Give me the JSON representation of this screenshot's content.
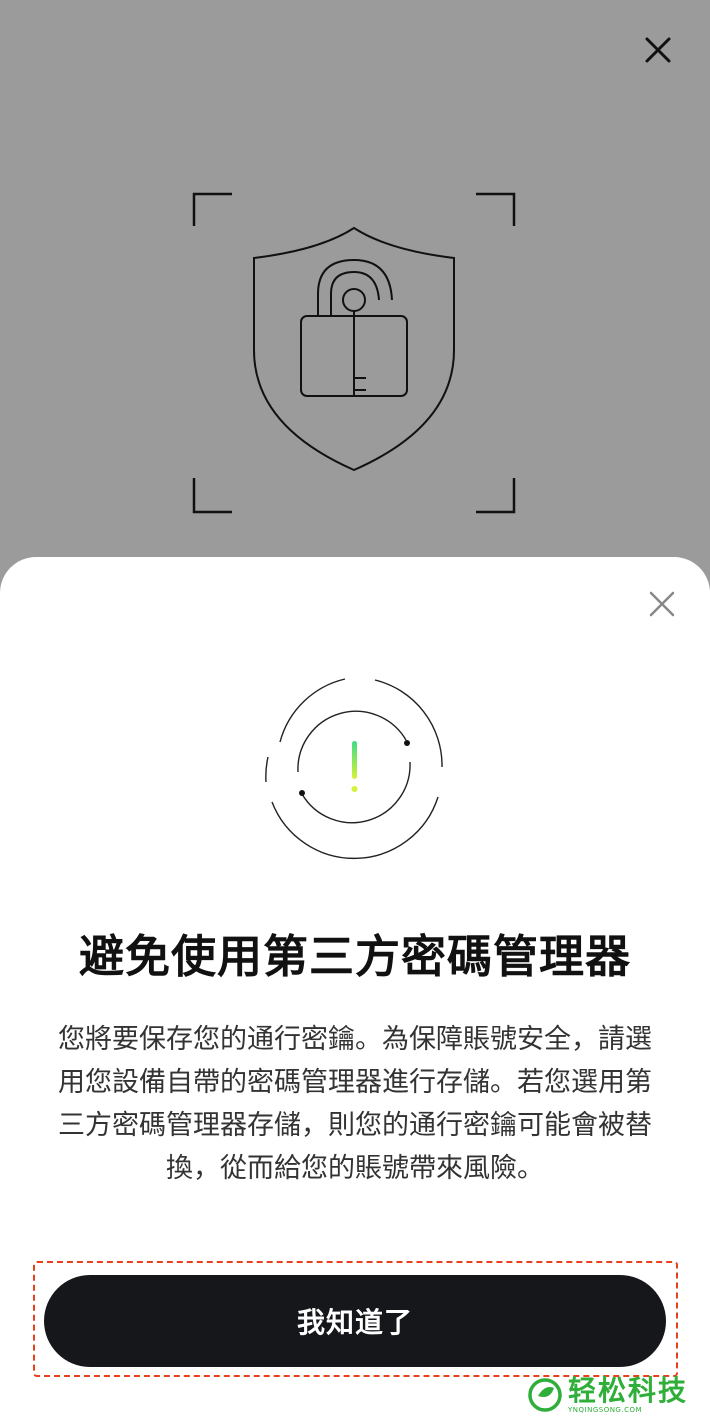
{
  "dialog": {
    "title": "避免使用第三方密碼管理器",
    "description": "您將要保存您的通行密鑰。為保障賬號安全，請選用您設備自帶的密碼管理器進行存儲。若您選用第三方密碼管理器存儲，則您的通行密鑰可能會被替換，從而給您的賬號帶來風險。",
    "confirm_label": "我知道了"
  },
  "watermark": {
    "text": "轻松科技",
    "subtext": "YNQINGSONG.COM"
  },
  "icons": {
    "top_close": "close-icon",
    "sheet_close": "close-icon",
    "hero": "shield-unlocked-padlock-icon",
    "alert": "exclamation-circle-icon",
    "watermark_logo": "leaf-logo"
  },
  "colors": {
    "overlay": "#9b9b9b",
    "sheet": "#ffffff",
    "button": "#16171a",
    "highlight": "#e8401c",
    "accent_gradient_top": "#3ddc84",
    "accent_gradient_bottom": "#d4f23a",
    "watermark": "#2fae3a"
  }
}
